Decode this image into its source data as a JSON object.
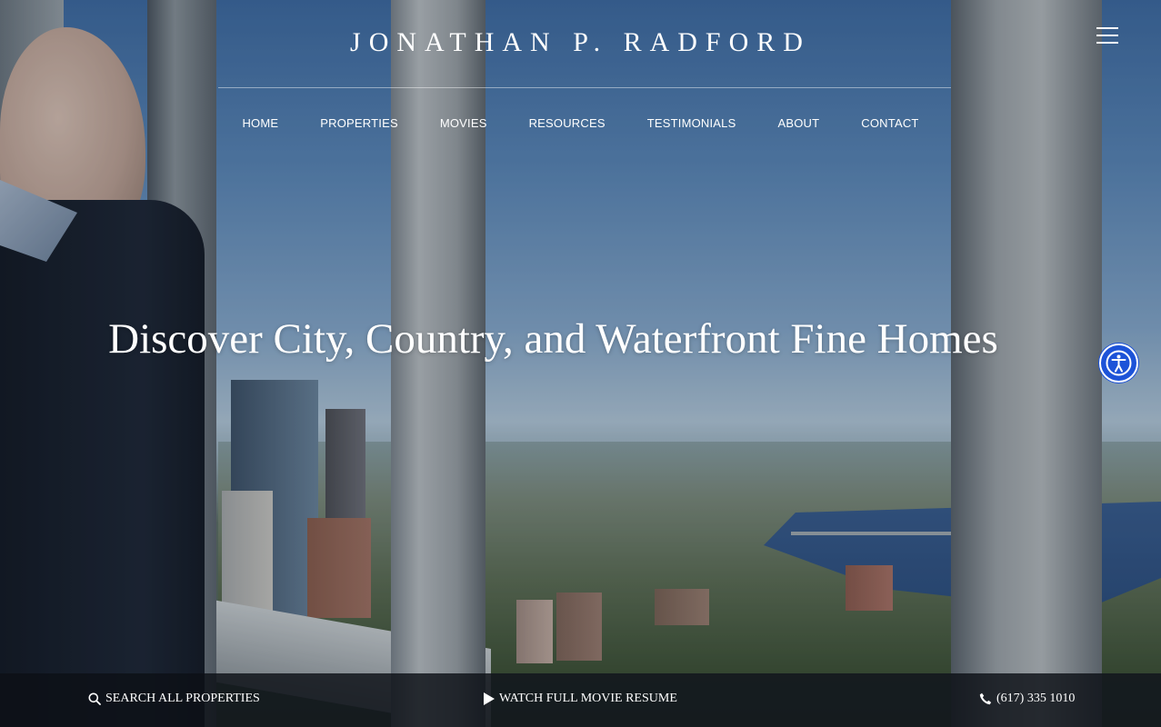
{
  "header": {
    "title": "JONATHAN P. RADFORD"
  },
  "nav": {
    "items": [
      {
        "label": "HOME"
      },
      {
        "label": "PROPERTIES"
      },
      {
        "label": "MOVIES"
      },
      {
        "label": "RESOURCES"
      },
      {
        "label": "TESTIMONIALS"
      },
      {
        "label": "ABOUT"
      },
      {
        "label": "CONTACT"
      }
    ]
  },
  "hero": {
    "headline": "Discover City, Country, and Waterfront Fine Homes"
  },
  "bottom_bar": {
    "search_label": "SEARCH ALL PROPERTIES",
    "movie_label": "WATCH FULL MOVIE RESUME",
    "phone_label": "(617) 335 1010"
  },
  "icons": {
    "menu": "hamburger-menu-icon",
    "accessibility": "accessibility-icon",
    "search": "search-icon",
    "play": "play-icon",
    "phone": "phone-icon"
  },
  "colors": {
    "accessibility_button": "#1d53d8",
    "bar_background": "#0c1016"
  }
}
